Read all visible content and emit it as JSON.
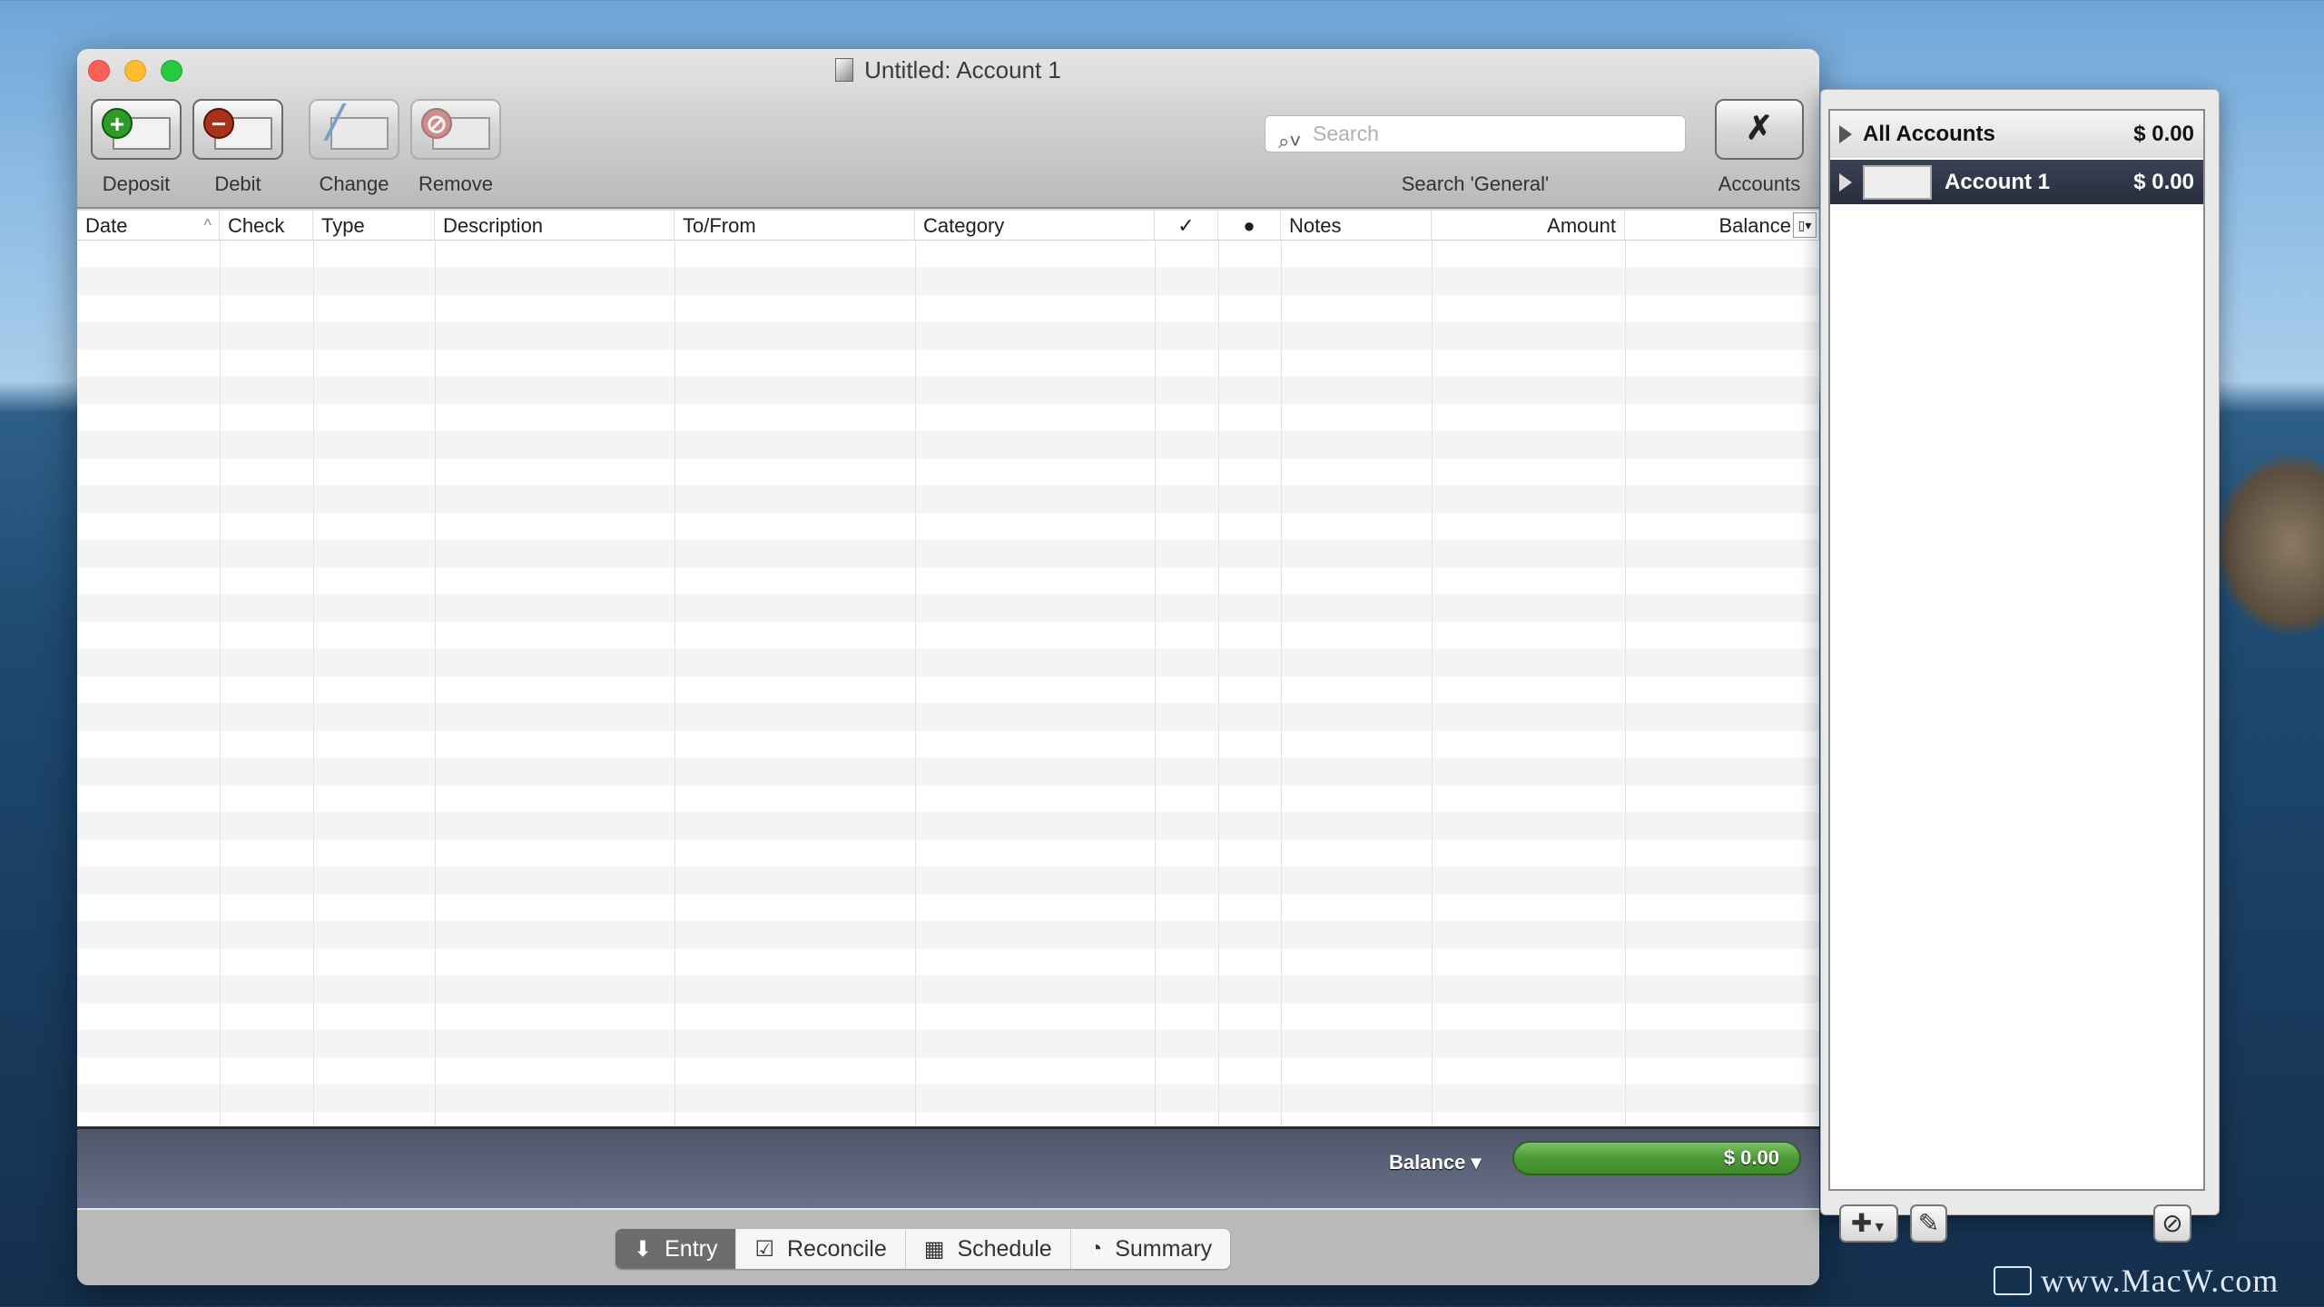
{
  "window": {
    "title": "Untitled:  Account 1"
  },
  "toolbar": {
    "deposit": "Deposit",
    "debit": "Debit",
    "change": "Change",
    "remove": "Remove",
    "search_placeholder": "Search",
    "search_scope": "Search 'General'",
    "accounts": "Accounts"
  },
  "table": {
    "columns": [
      "Date",
      "Check",
      "Type",
      "Description",
      "To/From",
      "Category",
      "✓",
      "●",
      "Notes",
      "Amount",
      "Balance"
    ],
    "rows": []
  },
  "balance": {
    "label": "Balance ▾",
    "value": "$ 0.00",
    "color": "#4c9a34"
  },
  "tabs": [
    {
      "label": "Entry",
      "icon": "entry-icon",
      "active": true
    },
    {
      "label": "Reconcile",
      "icon": "checkbox-icon"
    },
    {
      "label": "Schedule",
      "icon": "calendar-icon"
    },
    {
      "label": "Summary",
      "icon": "pie-chart-icon"
    }
  ],
  "accounts": {
    "items": [
      {
        "name": "All Accounts",
        "amount": "$ 0.00"
      },
      {
        "name": "Account 1",
        "amount": "$ 0.00",
        "selected": true
      }
    ]
  },
  "watermark": "www.MacW.com"
}
